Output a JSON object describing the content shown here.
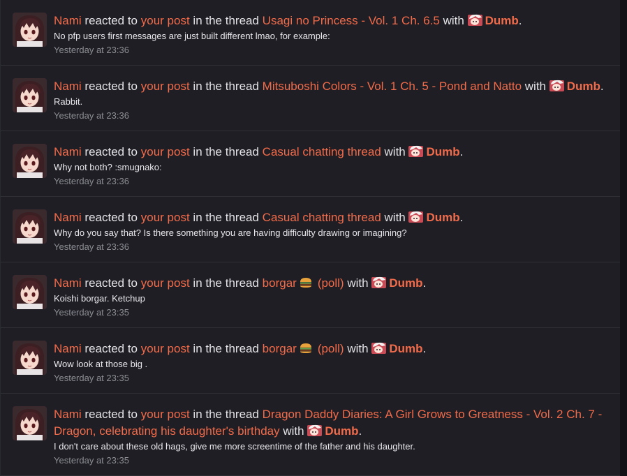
{
  "alerts": [
    {
      "user": "Nami",
      "verb": "reacted to",
      "post": "your post",
      "in_thread": "in the thread",
      "thread": "Usagi no Princess - Vol. 1 Ch. 6.5",
      "thread_suffix": "",
      "with": "with",
      "reaction": "Dumb",
      "snippet": "No pfp users first messages are just built different lmao, for example:",
      "time": "Yesterday at 23:36"
    },
    {
      "user": "Nami",
      "verb": "reacted to",
      "post": "your post",
      "in_thread": "in the thread",
      "thread": "Mitsuboshi Colors - Vol. 1 Ch. 5 - Pond and Natto",
      "thread_suffix": "",
      "with": "with",
      "reaction": "Dumb",
      "snippet": "Rabbit.",
      "time": "Yesterday at 23:36"
    },
    {
      "user": "Nami",
      "verb": "reacted to",
      "post": "your post",
      "in_thread": "in the thread",
      "thread": "Casual chatting thread",
      "thread_suffix": "",
      "with": "with",
      "reaction": "Dumb",
      "snippet": "Why not both? :smugnako:",
      "time": "Yesterday at 23:36"
    },
    {
      "user": "Nami",
      "verb": "reacted to",
      "post": "your post",
      "in_thread": "in the thread",
      "thread": "Casual chatting thread",
      "thread_suffix": "",
      "with": "with",
      "reaction": "Dumb",
      "snippet": "Why do you say that? Is there something you are having difficulty drawing or imagining?",
      "time": "Yesterday at 23:36"
    },
    {
      "user": "Nami",
      "verb": "reacted to",
      "post": "your post",
      "in_thread": "in the thread",
      "thread": "borgar",
      "thread_suffix": "(poll)",
      "with": "with",
      "reaction": "Dumb",
      "snippet": "Koishi borgar. Ketchup",
      "time": "Yesterday at 23:35"
    },
    {
      "user": "Nami",
      "verb": "reacted to",
      "post": "your post",
      "in_thread": "in the thread",
      "thread": "borgar",
      "thread_suffix": "(poll)",
      "with": "with",
      "reaction": "Dumb",
      "snippet": "Wow look at those big .",
      "time": "Yesterday at 23:35"
    },
    {
      "user": "Nami",
      "verb": "reacted to",
      "post": "your post",
      "in_thread": "in the thread",
      "thread": "Dragon Daddy Diaries: A Girl Grows to Greatness - Vol. 2 Ch. 7 - Dragon, celebrating his daughter's birthday",
      "thread_suffix": "",
      "with": "with",
      "reaction": "Dumb",
      "snippet": "I don't care about these old hags, give me more screentime of the father and his daughter.",
      "time": "Yesterday at 23:35"
    }
  ],
  "colors": {
    "link": "#f26b4a",
    "background": "#1e1e24",
    "text": "#e4e4e7",
    "muted": "#8c8c94"
  },
  "icons": {
    "avatar": "anime-girl-avatar-icon",
    "reaction": "dumb-reaction-icon",
    "burger": "burger-emoji-icon"
  }
}
